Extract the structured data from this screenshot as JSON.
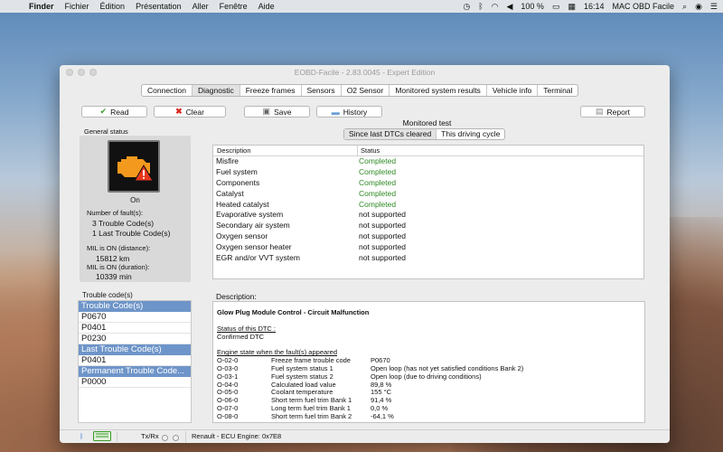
{
  "menubar": {
    "items": [
      "Finder",
      "Fichier",
      "Édition",
      "Présentation",
      "Aller",
      "Fenêtre",
      "Aide"
    ],
    "battery": "100 %",
    "time": "16:14",
    "user": "MAC OBD Facile"
  },
  "window": {
    "title": "EOBD-Facile - 2.83.0045 - Expert Edition"
  },
  "tabs": [
    "Connection",
    "Diagnostic",
    "Freeze frames",
    "Sensors",
    "O2 Sensor",
    "Monitored system results",
    "Vehicle info",
    "Terminal"
  ],
  "toolbar": {
    "read": "Read",
    "clear": "Clear",
    "save": "Save",
    "history": "History",
    "report": "Report"
  },
  "general_status": {
    "label": "General status",
    "state": "On",
    "faults_label": "Number of fault(s):",
    "faults_1": "3 Trouble Code(s)",
    "faults_2": "1 Last Trouble Code(s)",
    "mil_distance_label": "MIL is ON (distance):",
    "mil_distance": "15812 km",
    "mil_duration_label": "MIL is ON (duration):",
    "mil_duration": "10339 min"
  },
  "trouble_codes": {
    "label": "Trouble code(s)",
    "items": [
      {
        "text": "Trouble Code(s)",
        "kind": "header"
      },
      {
        "text": "P0670",
        "kind": "code"
      },
      {
        "text": "P0401",
        "kind": "code"
      },
      {
        "text": "P0230",
        "kind": "code"
      },
      {
        "text": "Last Trouble Code(s)",
        "kind": "header"
      },
      {
        "text": "P0401",
        "kind": "code"
      },
      {
        "text": "Permanent Trouble Code...",
        "kind": "header"
      },
      {
        "text": "P0000",
        "kind": "code"
      }
    ]
  },
  "monitored_test": {
    "title": "Monitored test",
    "segments": [
      "Since last DTCs cleared",
      "This driving cycle"
    ],
    "col_description": "Description",
    "col_status": "Status",
    "rows": [
      {
        "description": "Misfire",
        "status": "Completed"
      },
      {
        "description": "Fuel system",
        "status": "Completed"
      },
      {
        "description": "Components",
        "status": "Completed"
      },
      {
        "description": "Catalyst",
        "status": "Completed"
      },
      {
        "description": "Heated catalyst",
        "status": "Completed"
      },
      {
        "description": "Evaporative system",
        "status": "not supported"
      },
      {
        "description": "Secondary air system",
        "status": "not supported"
      },
      {
        "description": "Oxygen sensor",
        "status": "not supported"
      },
      {
        "description": "Oxygen sensor heater",
        "status": "not supported"
      },
      {
        "description": "EGR and/or VVT system",
        "status": "not supported"
      }
    ]
  },
  "description": {
    "label": "Description:",
    "title": "Glow Plug Module Control - Circuit Malfunction",
    "status_heading": "Status of this DTC :",
    "status_value": "Confirmed DTC",
    "engine_heading": "Engine state when the fault(s) appeared",
    "rows": [
      {
        "id": "O-02-0",
        "name": "Freeze frame trouble code",
        "value": "P0670"
      },
      {
        "id": "O-03-0",
        "name": "Fuel system status 1",
        "value": "Open loop (has not yet satisfied conditions Bank 2)"
      },
      {
        "id": "O-03-1",
        "name": "Fuel system status 2",
        "value": "Open loop (due to driving conditions)"
      },
      {
        "id": "O-04-0",
        "name": "Calculated load value",
        "value": "89,8 %"
      },
      {
        "id": "O-05-0",
        "name": "Coolant temperature",
        "value": "155 °C"
      },
      {
        "id": "O-06-0",
        "name": "Short term fuel trim Bank 1",
        "value": "91,4 %"
      },
      {
        "id": "O-07-0",
        "name": "Long term fuel trim Bank 1",
        "value": "0,0 %"
      },
      {
        "id": "O-08-0",
        "name": "Short term fuel trim Bank 2",
        "value": "-64,1 %"
      }
    ]
  },
  "statusbar": {
    "txrx": "Tx/Rx",
    "ecu": "Renault - ECU Engine: 0x7E8"
  },
  "colors": {
    "list_header": "#6e95c9",
    "completed": "#2e8a24",
    "engine_icon": "#f39a1e"
  }
}
